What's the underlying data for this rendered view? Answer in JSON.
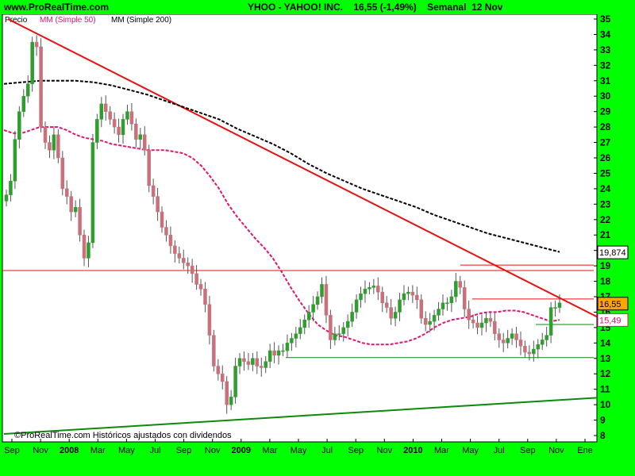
{
  "header": {
    "site": "www.ProRealTime.com",
    "title": "YHOO - YAHOO! INC.    16,55 (-1,49%)    Semanal  12 Nov"
  },
  "legend": {
    "price": "Precio",
    "ma50": "MM (Simple 50)",
    "ma200": "MM (Simple 200)"
  },
  "footer": "©ProRealTime.com  Históricos ajustados con dividendos",
  "colors": {
    "background": "#00FF00",
    "plot": "#FFFFFF",
    "up": "#2E9E2E",
    "down": "#C9707A",
    "ma50": "#E0146E",
    "ma200": "#000000",
    "trend": "#E81010",
    "support": "#0B8A0B"
  },
  "chart_data": {
    "type": "candlestick",
    "title": "YHOO - YAHOO! INC.",
    "last_price": "16,55",
    "change": "-1,49%",
    "interval": "Semanal",
    "date": "12 Nov",
    "ylim": [
      8,
      35
    ],
    "y_ticks": [
      "8",
      "9",
      "10",
      "11",
      "12",
      "13",
      "14",
      "15",
      "16",
      "17",
      "18",
      "19",
      "20",
      "21",
      "22",
      "23",
      "24",
      "25",
      "26",
      "27",
      "28",
      "29",
      "30",
      "31",
      "32",
      "33",
      "34",
      "35"
    ],
    "x_labels": [
      "Sep",
      "Nov",
      "2008",
      "Mar",
      "May",
      "Jul",
      "Sep",
      "Nov",
      "2009",
      "Mar",
      "May",
      "Jul",
      "Sep",
      "Nov",
      "2010",
      "Mar",
      "May",
      "Jul",
      "Sep",
      "Nov",
      "Ene"
    ],
    "value_labels": [
      {
        "text": "19,874",
        "value": 19.874,
        "series": "MM (Simple 200)"
      },
      {
        "text": "16,55",
        "value": 16.55,
        "series": "Precio"
      },
      {
        "text": "15,49",
        "value": 15.49,
        "series": "MM (Simple 50)"
      }
    ],
    "series": [
      {
        "name": "Precio",
        "style": "candles",
        "close": [
          23.6,
          24.5,
          27.2,
          29.0,
          30.0,
          30.8,
          33.5,
          33.2,
          28.0,
          27.0,
          26.5,
          27.5,
          26.0,
          24.0,
          23.5,
          22.5,
          22.8,
          21.0,
          19.5,
          20.5,
          27.0,
          28.5,
          29.5,
          29.0,
          28.5,
          28.0,
          27.5,
          28.5,
          29.0,
          28.2,
          27.2,
          27.5,
          26.5,
          24.2,
          23.5,
          22.5,
          21.5,
          21.0,
          20.3,
          19.8,
          19.5,
          19.2,
          19.0,
          18.5,
          17.8,
          17.5,
          16.5,
          14.5,
          12.5,
          12.0,
          11.5,
          10.0,
          10.5,
          12.5,
          13.0,
          12.8,
          12.6,
          13.0,
          12.5,
          12.4,
          12.8,
          13.5,
          13.2,
          13.5,
          13.5,
          14.0,
          14.3,
          14.6,
          15.0,
          15.5,
          16.0,
          16.5,
          17.0,
          17.8,
          15.8,
          14.2,
          14.6,
          14.6,
          15.0,
          15.4,
          16.0,
          16.8,
          17.2,
          17.5,
          17.6,
          17.7,
          17.3,
          16.6,
          16.3,
          15.6,
          16.0,
          16.8,
          17.2,
          17.3,
          17.1,
          16.8,
          15.6,
          15.2,
          15.4,
          15.8,
          16.2,
          16.6,
          16.6,
          17.0,
          18.0,
          17.6,
          16.2,
          15.5,
          15.3,
          15.0,
          15.3,
          15.6,
          15.4,
          14.6,
          14.2,
          14.0,
          14.3,
          14.6,
          14.2,
          13.8,
          13.4,
          13.3,
          13.6,
          13.9,
          14.2,
          14.5,
          16.3,
          16.3,
          16.6
        ],
        "ohlc_note": "weekly candles Sep 2007 – Nov 2010"
      },
      {
        "name": "MM (Simple 50)",
        "style": "dashed",
        "color": "#E0146E",
        "values": [
          27.8,
          27.6,
          27.6,
          27.8,
          28.0,
          28.0,
          28.0,
          27.8,
          27.5,
          27.3,
          27.2,
          27.1,
          26.9,
          26.8,
          26.7,
          26.6,
          26.5,
          26.5,
          26.5,
          26.4,
          26.3,
          26.0,
          25.5,
          24.8,
          24.0,
          23.0,
          22.2,
          21.5,
          20.8,
          20.2,
          19.5,
          18.6,
          17.6,
          16.7,
          15.9,
          15.2,
          14.8,
          14.5,
          14.4,
          14.2,
          14.0,
          13.9,
          13.9,
          13.9,
          14.0,
          14.1,
          14.3,
          14.6,
          15.0,
          15.3,
          15.5,
          15.6,
          15.7,
          15.9,
          16.0,
          16.0,
          16.1,
          16.1,
          16.0,
          15.8,
          15.6,
          15.4,
          15.5
        ]
      },
      {
        "name": "MM (Simple 200)",
        "style": "dashed",
        "color": "#000000",
        "values": [
          30.8,
          30.9,
          31.0,
          31.0,
          31.0,
          30.9,
          30.7,
          30.4,
          30.1,
          29.7,
          29.3,
          28.9,
          28.5,
          27.9,
          27.4,
          26.9,
          26.3,
          25.6,
          25.0,
          24.5,
          24.0,
          23.6,
          23.2,
          22.8,
          22.3,
          21.9,
          21.5,
          21.1,
          20.8,
          20.5,
          20.2,
          19.9
        ]
      },
      {
        "name": "Trend line",
        "style": "line",
        "color": "#E81010",
        "from": 35.0,
        "to": 15.7
      },
      {
        "name": "Support line",
        "style": "line",
        "color": "#0B8A0B",
        "from": 8.1,
        "to": 10.45
      }
    ],
    "horizontal_levels": [
      {
        "value": 18.7,
        "color": "#E81010"
      },
      {
        "value": 19.05,
        "color": "#E81010"
      },
      {
        "value": 16.85,
        "color": "#E81010"
      },
      {
        "value": 15.2,
        "color": "#0B8A0B"
      },
      {
        "value": 13.05,
        "color": "#0B8A0B"
      }
    ]
  }
}
